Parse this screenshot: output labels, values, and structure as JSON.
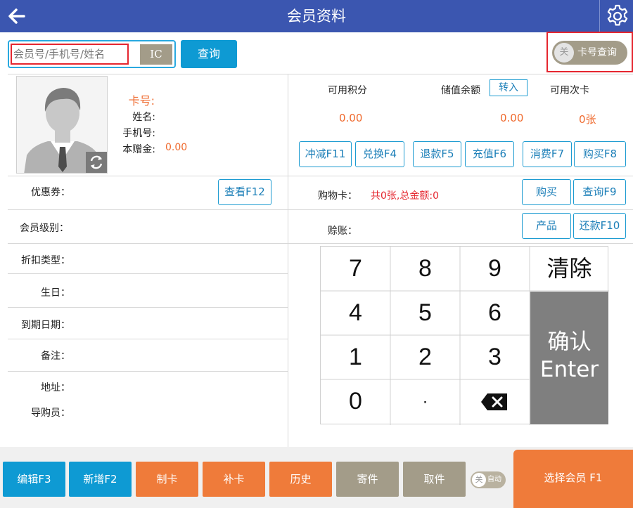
{
  "header": {
    "title": "会员资料",
    "back_icon": "arrow-left-icon",
    "settings_icon": "gear-icon",
    "background": "#3b56b0"
  },
  "search": {
    "placeholder": "会员号/手机号/姓名",
    "ic_label": "IC",
    "query_label": "查询"
  },
  "card_query_toggle": {
    "state_label": "关",
    "label": "卡号查询"
  },
  "profile": {
    "card_no_label": "卡号:",
    "name_label": "姓名:",
    "phone_label": "手机号:",
    "gift_label": "本赠金:",
    "gift_value": "0.00",
    "avatar_icon": "user-avatar-icon",
    "refresh_icon": "refresh-icon"
  },
  "stats": {
    "points_label": "可用积分",
    "points_value": "0.00",
    "balance_label": "储值余额",
    "transfer_label": "转入",
    "balance_value": "0.00",
    "times_card_label": "可用次卡",
    "times_card_value": "0张"
  },
  "action_buttons": [
    "冲减F11",
    "兑换F4",
    "退款F5",
    "充值F6",
    "消费F7",
    "购买F8"
  ],
  "coupons": {
    "label": "优惠券：",
    "view_label": "查看F12"
  },
  "shopping_card": {
    "label": "购物卡：",
    "summary": "共0张,总金额:0",
    "buy_label": "购买",
    "query_label": "查询F9"
  },
  "credit": {
    "label": "赊账：",
    "product_label": "产品",
    "repay_label": "还款F10"
  },
  "fields": {
    "level": "会员级别：",
    "discount": "折扣类型：",
    "birthday": "生日：",
    "expiry": "到期日期：",
    "remark": "备注：",
    "address": "地址：",
    "guide": "导购员："
  },
  "keypad": {
    "keys": [
      "7",
      "8",
      "9",
      "4",
      "5",
      "6",
      "1",
      "2",
      "3",
      "0",
      "·"
    ],
    "clear_label": "清除",
    "enter_line1": "确认",
    "enter_line2": "Enter",
    "backspace_icon": "backspace-icon"
  },
  "bottom": {
    "edit": "编辑F3",
    "add": "新增F2",
    "make_card": "制卡",
    "reissue": "补卡",
    "history": "历史",
    "deposit": "寄件",
    "pickup": "取件",
    "auto_state": "关",
    "auto_label": "自动",
    "select_member": "选择会员 F1"
  },
  "colors": {
    "accent_blue": "#0e9ad3",
    "orange": "#ef7b3a",
    "taupe": "#a39c89",
    "highlight_red": "#e5262f"
  }
}
